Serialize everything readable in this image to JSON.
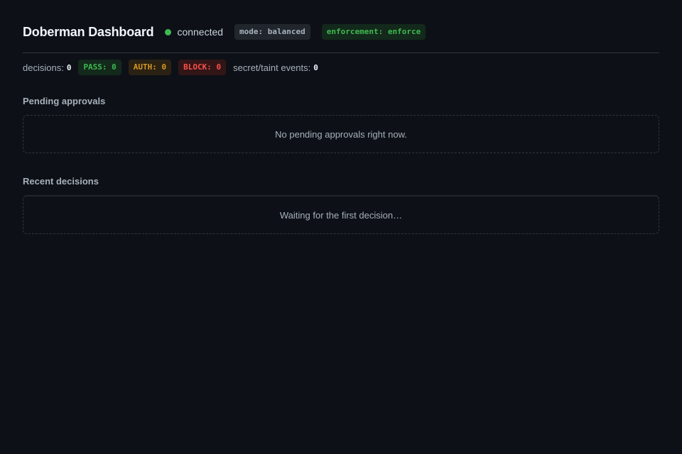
{
  "header": {
    "title": "Doberman Dashboard",
    "status_label": "connected",
    "status_color": "#3fb950",
    "mode_pill": "mode: balanced",
    "enforcement_pill": "enforcement: enforce"
  },
  "stats": {
    "decisions_label": "decisions:",
    "decisions_count": "0",
    "pass_pill": "PASS: 0",
    "auth_pill": "AUTH: 0",
    "block_pill": "BLOCK: 0",
    "taint_label": "secret/taint events:",
    "taint_count": "0"
  },
  "pending": {
    "title": "Pending approvals",
    "empty_text": "No pending approvals right now."
  },
  "recent": {
    "title": "Recent decisions",
    "empty_text": "Waiting for the first decision…"
  },
  "colors": {
    "background": "#0d1117",
    "pass": "#3fb950",
    "auth": "#d29922",
    "block": "#f85149"
  }
}
